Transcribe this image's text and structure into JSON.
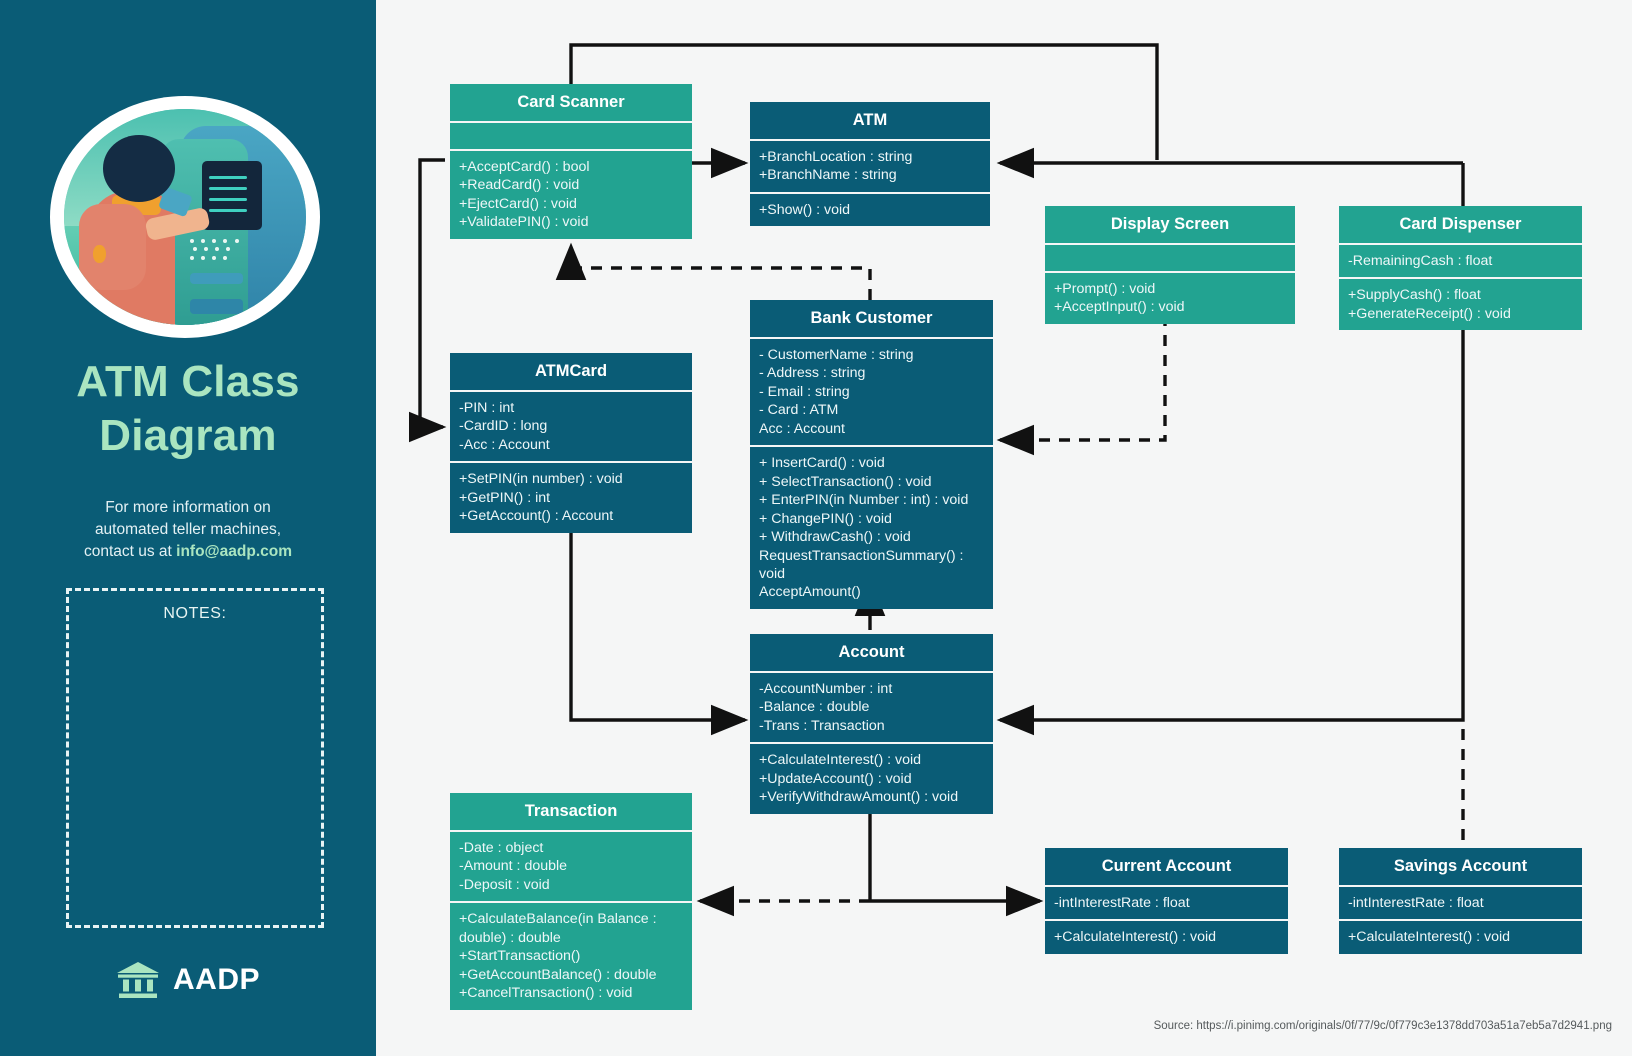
{
  "sidebar": {
    "title": "ATM Class\nDiagram",
    "title_line1": "ATM Class",
    "title_line2": "Diagram",
    "subtitle_line1": "For more information on",
    "subtitle_line2": "automated teller machines,",
    "subtitle_line3_prefix": "contact  us at ",
    "subtitle_email": "info@aadp.com",
    "notes_label": "NOTES:",
    "brand_name": "AADP",
    "brand_icon": "bank-building-icon",
    "illustration": "person-using-atm-illustration"
  },
  "source_text": "Source: https://i.pinimg.com/originals/0f/77/9c/0f779c3e1378dd703a51a7eb5a7d2941.png",
  "colors": {
    "panel_bg": "#0a5c76",
    "canvas_bg": "#f5f6f6",
    "teal": "#22a391",
    "navy": "#0a5c76",
    "title_green": "#aae5c0",
    "connector": "#111111"
  },
  "classes": {
    "card_scanner": {
      "name": "Card Scanner",
      "style": "teal",
      "attributes": [],
      "methods": [
        "+AcceptCard() : bool",
        "+ReadCard() : void",
        "+EjectCard() : void",
        "+ValidatePIN() : void"
      ]
    },
    "atm": {
      "name": "ATM",
      "style": "navy",
      "attributes": [
        "+BranchLocation : string",
        "+BranchName : string"
      ],
      "methods": [
        "+Show() : void"
      ]
    },
    "display_screen": {
      "name": "Display Screen",
      "style": "teal",
      "attributes": [],
      "methods": [
        "+Prompt() : void",
        "+AcceptInput() : void"
      ]
    },
    "card_dispenser": {
      "name": "Card Dispenser",
      "style": "teal",
      "attributes": [
        "-RemainingCash : float"
      ],
      "methods": [
        "+SupplyCash() : float",
        "+GenerateReceipt() : void"
      ]
    },
    "atmcard": {
      "name": "ATMCard",
      "style": "navy",
      "attributes": [
        "-PIN : int",
        "-CardID : long",
        "-Acc : Account"
      ],
      "methods": [
        "+SetPIN(in number) : void",
        "+GetPIN() : int",
        "+GetAccount() : Account"
      ]
    },
    "bank_customer": {
      "name": "Bank Customer",
      "style": "navy",
      "attributes": [
        "- CustomerName : string",
        "- Address : string",
        "- Email : string",
        "- Card : ATM",
        "Acc : Account"
      ],
      "methods": [
        "+ InsertCard() : void",
        "+ SelectTransaction() : void",
        "+ EnterPIN(in Number : int) : void",
        "+ ChangePIN() : void",
        "+ WithdrawCash() : void",
        "RequestTransactionSummary() : void",
        "AcceptAmount()"
      ]
    },
    "account": {
      "name": "Account",
      "style": "navy",
      "attributes": [
        "-AccountNumber : int",
        "-Balance : double",
        "-Trans : Transaction"
      ],
      "methods": [
        "+CalculateInterest() : void",
        "+UpdateAccount() : void",
        "+VerifyWithdrawAmount() : void"
      ]
    },
    "transaction": {
      "name": "Transaction",
      "style": "teal",
      "attributes": [
        "-Date : object",
        "-Amount : double",
        "-Deposit : void"
      ],
      "methods": [
        "+CalculateBalance(in Balance : double) : double",
        "+StartTransaction()",
        "+GetAccountBalance() : double",
        "+CancelTransaction() : void"
      ]
    },
    "current_account": {
      "name": "Current Account",
      "style": "navy",
      "attributes": [
        "-intInterestRate : float"
      ],
      "methods": [
        "+CalculateInterest() : void"
      ]
    },
    "savings_account": {
      "name": "Savings Account",
      "style": "navy",
      "attributes": [
        "-intInterestRate : float"
      ],
      "methods": [
        "+CalculateInterest() : void"
      ]
    }
  }
}
